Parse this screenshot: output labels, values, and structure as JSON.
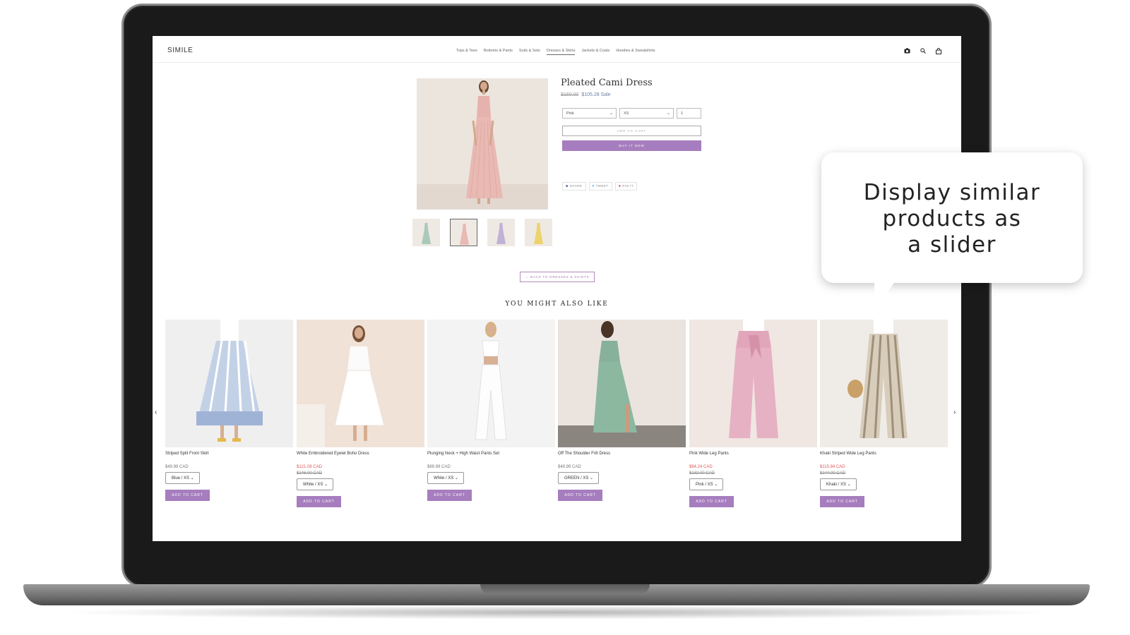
{
  "store": {
    "logo": "SIMILE",
    "nav": [
      "Tops & Tees",
      "Bottoms & Pants",
      "Suits & Sets",
      "Dresses & Skirts",
      "Jackets & Coats",
      "Hoodies & Sweatshirts"
    ],
    "active_nav": "Dresses & Skirts"
  },
  "product": {
    "title": "Pleated Cami Dress",
    "compare_price": "$160.00",
    "price": "$105.28",
    "sale_label": "Sale",
    "color_option": "Pink",
    "size_option": "XS",
    "quantity": "1",
    "add_to_cart": "ADD TO CART",
    "buy_now": "BUY IT NOW",
    "share": [
      "SHARE",
      "TWEET",
      "PIN IT"
    ],
    "back_link": "← BACK TO DRESSES & SKIRTS"
  },
  "related": {
    "heading": "YOU MIGHT ALSO LIKE",
    "items": [
      {
        "name": "Striped Split Front Skirt",
        "price": "$49.99 CAD",
        "compare": "",
        "variant": "Blue / XS",
        "button": "ADD TO CART"
      },
      {
        "name": "White Embroidered Eyelet Boho Dress",
        "price": "$121.08 CAD",
        "compare": "$146.00 CAD",
        "variant": "White / XS",
        "button": "ADD TO CART"
      },
      {
        "name": "Plunging Neck + High Waist Pants Set",
        "price": "$89.99 CAD",
        "compare": "",
        "variant": "White / XS",
        "button": "ADD TO CART"
      },
      {
        "name": "Off The Shoulder Frill Dress",
        "price": "$49.99 CAD",
        "compare": "",
        "variant": "GREEN / XS",
        "button": "ADD TO CART"
      },
      {
        "name": "Pink Wide Leg Pants",
        "price": "$84.24 CAD",
        "compare": "$132.00 CAD",
        "variant": "Pink / XS",
        "button": "ADD TO CART"
      },
      {
        "name": "Khaki Striped Wide Leg Pants",
        "price": "$115.84 CAD",
        "compare": "$144.00 CAD",
        "variant": "Khaki / XS",
        "button": "ADD TO CART"
      }
    ]
  },
  "callout": {
    "line1": "Display similar",
    "line2": "products as",
    "line3": "a slider"
  },
  "colors": {
    "accent_button": "#a67dbe",
    "sale_price": "#e05757",
    "dress_pink": "#e7b5b0"
  }
}
